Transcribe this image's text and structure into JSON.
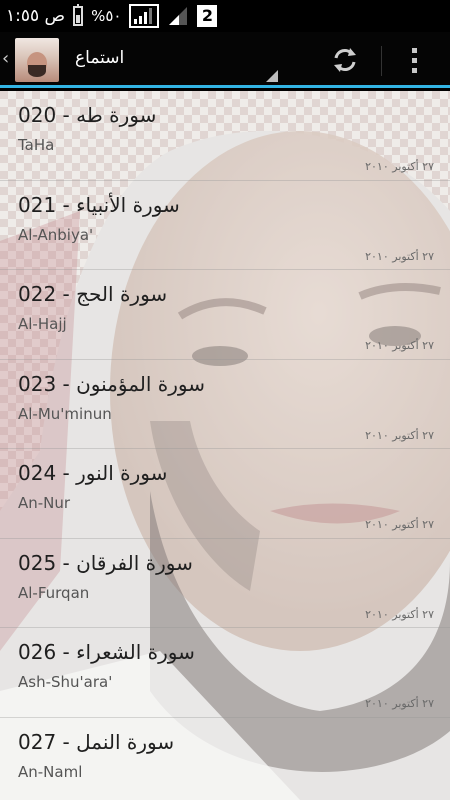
{
  "status_bar": {
    "time": "ص ١:٥٥",
    "battery_percent": "%٥٠",
    "sim_badge": "2"
  },
  "action_bar": {
    "title": "استماع",
    "refresh_icon": "refresh-icon",
    "overflow_icon": "overflow-menu-icon",
    "accent_color": "#33b5e5"
  },
  "list": {
    "items": [
      {
        "title": "020 - سورة طه",
        "subtitle": "TaHa",
        "date": "٢٧ أكتوبر ٢٠١٠"
      },
      {
        "title": "021 - سورة الأنبياء",
        "subtitle": "Al-Anbiya'",
        "date": "٢٧ أكتوبر ٢٠١٠"
      },
      {
        "title": "022 - سورة الحج",
        "subtitle": "Al-Hajj",
        "date": "٢٧ أكتوبر ٢٠١٠"
      },
      {
        "title": "023 - سورة المؤمنون",
        "subtitle": "Al-Mu'minun",
        "date": "٢٧ أكتوبر ٢٠١٠"
      },
      {
        "title": "024 - سورة النور",
        "subtitle": "An-Nur",
        "date": "٢٧ أكتوبر ٢٠١٠"
      },
      {
        "title": "025 - سورة الفرقان",
        "subtitle": "Al-Furqan",
        "date": "٢٧ أكتوبر ٢٠١٠"
      },
      {
        "title": "026 - سورة الشعراء",
        "subtitle": "Ash-Shu'ara'",
        "date": "٢٧ أكتوبر ٢٠١٠"
      },
      {
        "title": "027 - سورة النمل",
        "subtitle": "An-Naml",
        "date": ""
      }
    ]
  }
}
